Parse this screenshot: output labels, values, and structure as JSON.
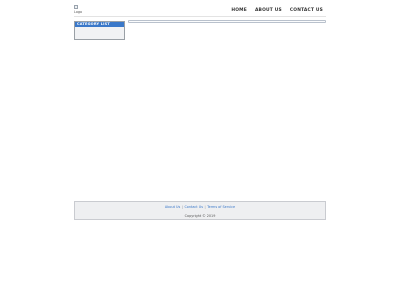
{
  "header": {
    "logo_alt": "Logo",
    "nav": [
      "HOME",
      "ABOUT US",
      "CONTACT US"
    ]
  },
  "sidebar": {
    "title": "CATEGORY LIST"
  },
  "footer": {
    "links": [
      "About Us",
      "Contact Us",
      "Terms of Service"
    ],
    "separator": "|",
    "copyright": "Copyright © 2019"
  },
  "colors": {
    "accent": "#3a78c9",
    "panel_bg": "#eeeff1",
    "border": "#9aa0a6"
  }
}
